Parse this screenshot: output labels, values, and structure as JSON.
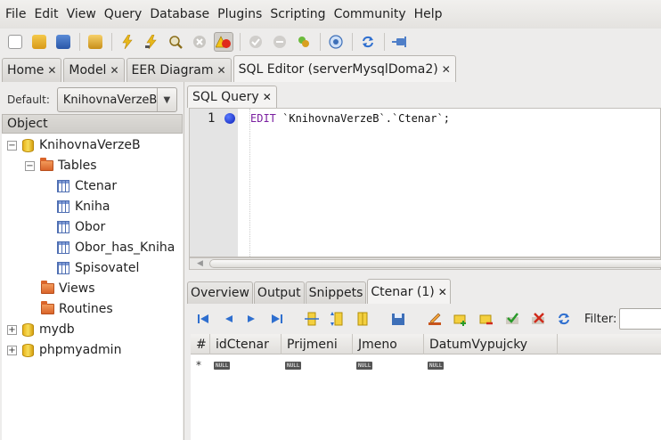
{
  "menubar": {
    "items": [
      "File",
      "Edit",
      "View",
      "Query",
      "Database",
      "Plugins",
      "Scripting",
      "Community",
      "Help"
    ]
  },
  "toolbar": {
    "icons": [
      "new-query-icon",
      "open-file-icon",
      "save-file-icon",
      "snippet-icon",
      "execute-icon",
      "execute-current-icon",
      "explain-icon",
      "stop-icon",
      "toggle-error-icon",
      "commit-icon",
      "rollback-icon",
      "autocommit-icon",
      "reconnect-icon",
      "refresh-icon",
      "pin-icon"
    ]
  },
  "top_tabs": [
    {
      "label": "Home"
    },
    {
      "label": "Model"
    },
    {
      "label": "EER Diagram"
    },
    {
      "label": "SQL Editor (serverMysqlDoma2)"
    }
  ],
  "left": {
    "default_label": "Default:",
    "default_value": "KnihovnaVerzeB",
    "object_header": "Object",
    "tree": {
      "db1": "KnihovnaVerzeB",
      "tables": "Tables",
      "tbl1": "Ctenar",
      "tbl2": "Kniha",
      "tbl3": "Obor",
      "tbl4": "Obor_has_Kniha",
      "tbl5": "Spisovatel",
      "views": "Views",
      "routines": "Routines",
      "db2": "mydb",
      "db3": "phpmyadmin",
      "collapse": "−",
      "expand": "+"
    }
  },
  "editor": {
    "tab_label": "SQL Query",
    "line_number": "1",
    "keyword": "EDIT",
    "code_rest": " `KnihovnaVerzeB`.`Ctenar`;"
  },
  "bottom_tabs": [
    {
      "label": "Overview"
    },
    {
      "label": "Output"
    },
    {
      "label": "Snippets"
    },
    {
      "label": "Ctenar (1)"
    }
  ],
  "results": {
    "filter_label": "Filter:",
    "columns": [
      "#",
      "idCtenar",
      "Prijmeni",
      "Jmeno",
      "DatumVypujcky"
    ],
    "row_marker": "*",
    "null_text": "NULL"
  },
  "close_glyph": "✕"
}
